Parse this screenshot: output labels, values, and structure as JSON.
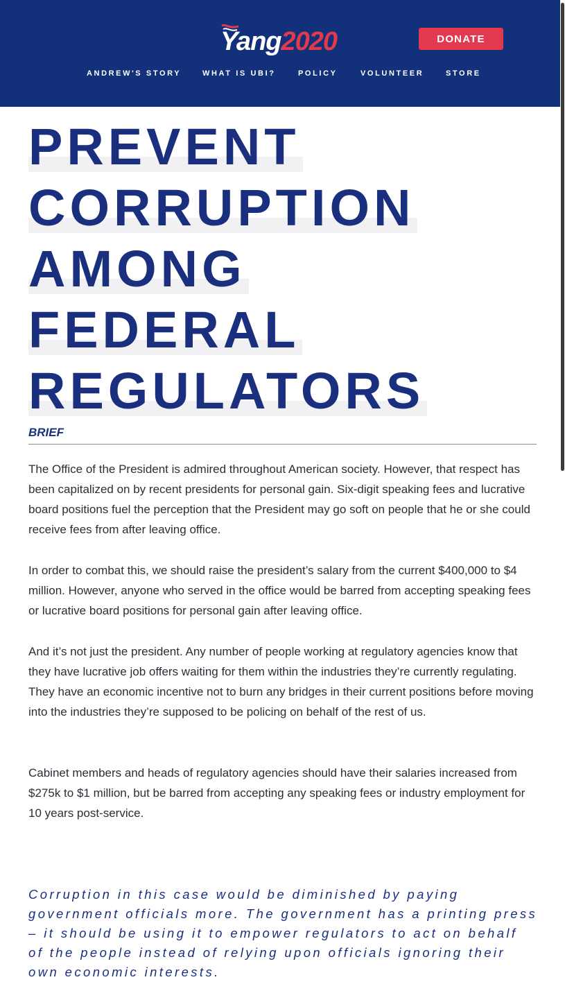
{
  "header": {
    "logo": {
      "name": "Yang",
      "year": "2020"
    },
    "donate_label": "DONATE",
    "nav": [
      "ANDREW'S STORY",
      "WHAT IS UBI?",
      "POLICY",
      "VOLUNTEER",
      "STORE"
    ]
  },
  "article": {
    "title_lines": [
      "PREVENT",
      "CORRUPTION",
      "AMONG",
      "FEDERAL",
      "REGULATORS"
    ],
    "brief_heading": "BRIEF",
    "paragraphs": [
      "The Office of the President is admired throughout American society. However, that respect has been capitalized on by recent presidents for personal gain. Six-digit speaking fees and lucrative board positions fuel the perception that the President may go soft on people that he or she could receive fees from after leaving office.",
      "In order to combat this, we should raise the president’s salary from the current $400,000 to $4 million. However, anyone who served in the office would be barred from accepting speaking fees or lucrative board positions for personal gain after leaving office.",
      "And it’s not just the president. Any number of people working at regulatory agencies know that they have lucrative job offers waiting for them within the industries they’re currently regulating. They have an economic incentive not to burn any bridges in their current positions before moving into the industries they’re supposed to be policing on behalf of the rest of us.",
      "Cabinet members and heads of regulatory agencies should have their salaries increased from $275k to $1 million, but be barred from accepting any speaking fees or industry employment for 10 years post-service."
    ],
    "quote": "Corruption in this case would be diminished by paying government officials more. The government has a printing press – it should be using it to empower regulators to act on behalf of the people instead of relying upon officials ignoring their own economic interests."
  },
  "colors": {
    "header_bg": "#13307a",
    "accent_red": "#e1394d",
    "title_blue": "#1a2f7e"
  }
}
